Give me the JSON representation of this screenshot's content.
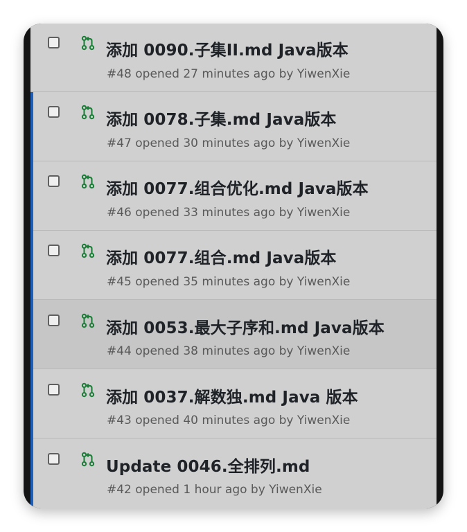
{
  "pull_requests": [
    {
      "title": "添加 0090.子集II.md Java版本",
      "meta": "#48 opened 27 minutes ago by YiwenXie"
    },
    {
      "title": "添加 0078.子集.md Java版本",
      "meta": "#47 opened 30 minutes ago by YiwenXie"
    },
    {
      "title": "添加 0077.组合优化.md Java版本",
      "meta": "#46 opened 33 minutes ago by YiwenXie"
    },
    {
      "title": "添加 0077.组合.md Java版本",
      "meta": "#45 opened 35 minutes ago by YiwenXie"
    },
    {
      "title": "添加 0053.最大子序和.md Java版本",
      "meta": "#44 opened 38 minutes ago by YiwenXie"
    },
    {
      "title": "添加 0037.解数独.md Java 版本",
      "meta": "#43 opened 40 minutes ago by YiwenXie"
    },
    {
      "title": "Update 0046.全排列.md",
      "meta": "#42 opened 1 hour ago by YiwenXie"
    }
  ],
  "colors": {
    "accent_bar": "#1f5fb8",
    "pr_open_icon": "#1a7f37"
  }
}
